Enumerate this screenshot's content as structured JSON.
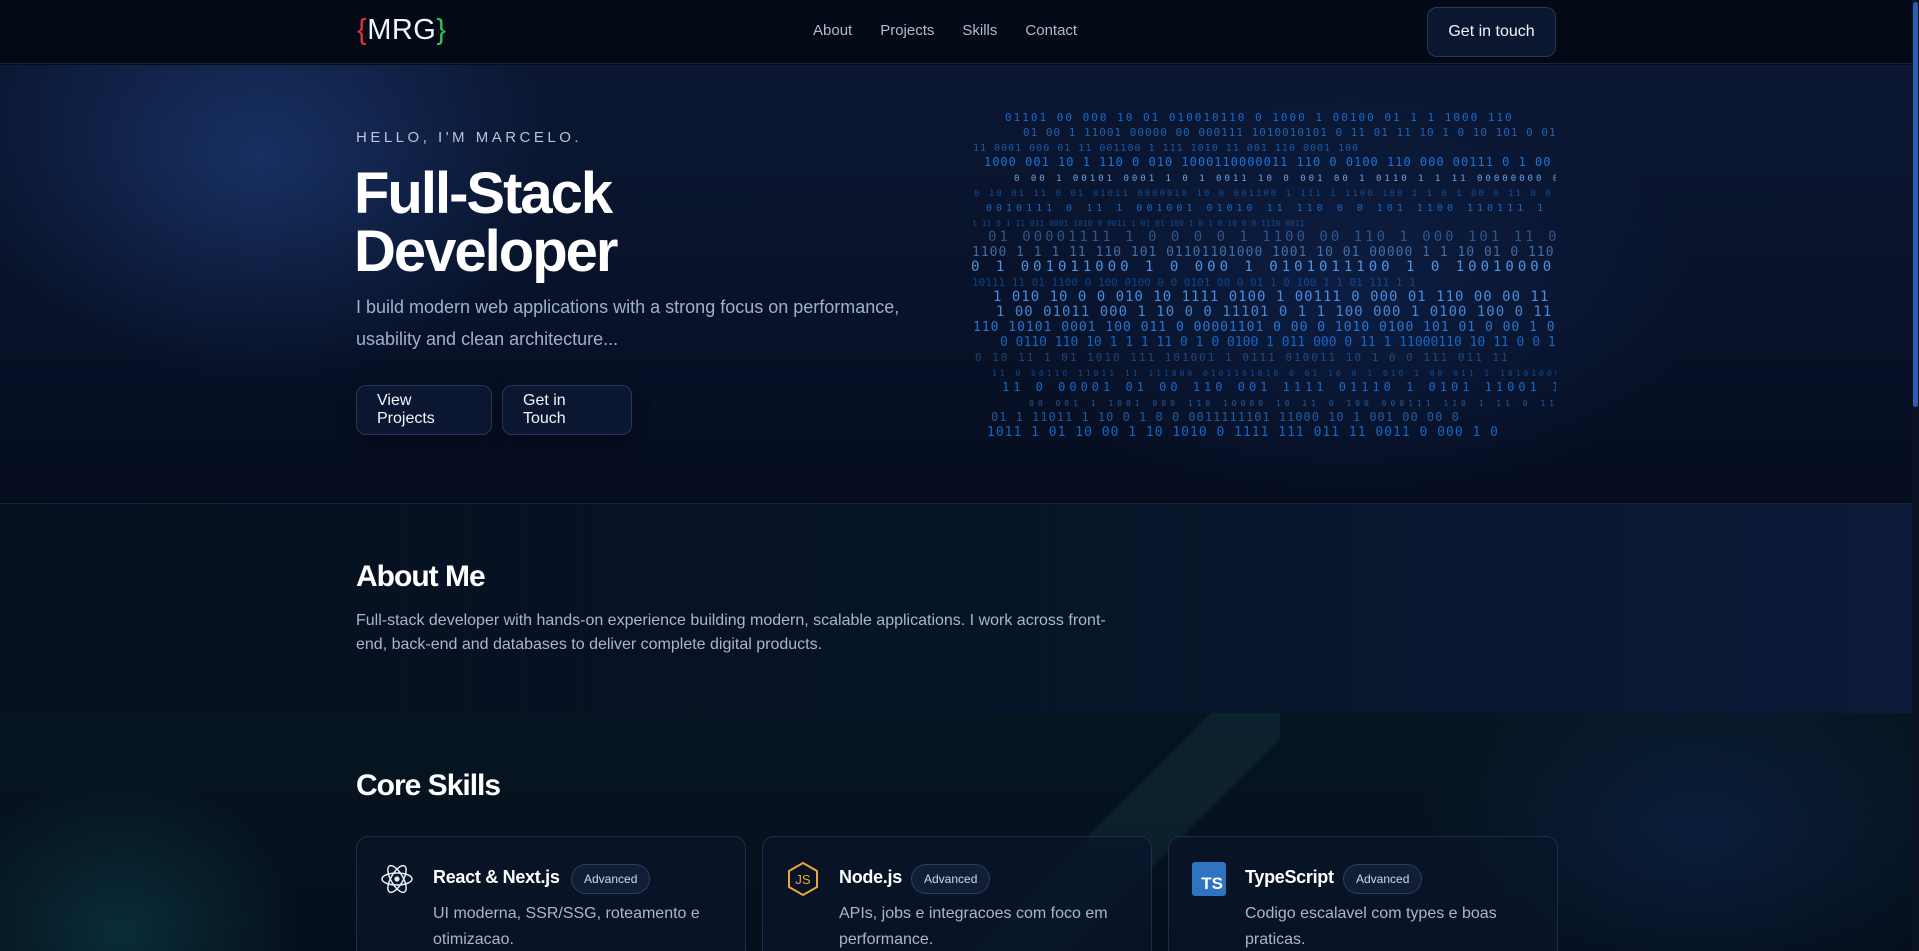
{
  "header": {
    "logo": {
      "open": "{",
      "text": "MRG",
      "close": "}"
    },
    "nav": [
      {
        "label": "About"
      },
      {
        "label": "Projects"
      },
      {
        "label": "Skills"
      },
      {
        "label": "Contact"
      }
    ],
    "cta_label": "Get in touch"
  },
  "hero": {
    "eyebrow": "HELLO, I'M MARCELO.",
    "title_line1": "Full-Stack",
    "title_line2": "Developer",
    "description": "I build modern web applications with a strong focus on performance, usability and clean architecture...",
    "primary_button": "View Projects",
    "secondary_button": "Get in Touch"
  },
  "about": {
    "title": "About Me",
    "text": "Full-stack developer with hands-on experience building modern, scalable applications. I work across front-end, back-end and databases to deliver complete digital products."
  },
  "skills": {
    "title": "Core Skills",
    "items": [
      {
        "icon": "react-icon",
        "name": "React & Next.js",
        "level": "Advanced",
        "description": "UI moderna, SSR/SSG, roteamento e otimizacao."
      },
      {
        "icon": "js-icon",
        "name": "Node.js",
        "level": "Advanced",
        "description": "APIs, jobs e integracoes com foco em performance."
      },
      {
        "icon": "ts-icon",
        "name": "TypeScript",
        "level": "Advanced",
        "description": "Codigo escalavel com types e boas praticas."
      }
    ]
  },
  "colors": {
    "background": "#050b1a",
    "accent_blue": "#2a7be4",
    "logo_bracket_left": "#e0323a",
    "logo_bracket_right": "#33c15a",
    "js_icon": "#e8a93a",
    "ts_icon": "#2f74c0"
  }
}
